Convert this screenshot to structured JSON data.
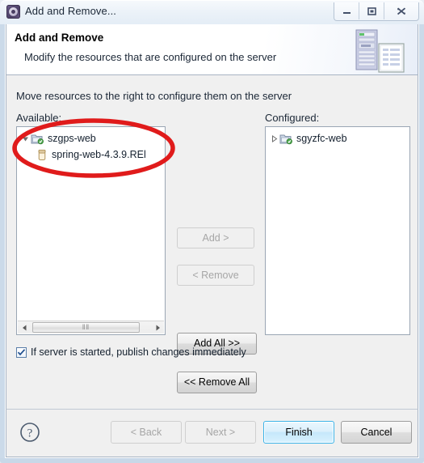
{
  "window": {
    "title": "Add and Remove...",
    "icon": "eclipse-server-icon",
    "controls": {
      "minimize": "minimize-button",
      "restore": "restore-button",
      "close": "close-button"
    }
  },
  "header": {
    "title": "Add and Remove",
    "subtitle": "Modify the resources that are configured on the server",
    "icon": "server-and-document-icon"
  },
  "main": {
    "instruction": "Move resources to the right to configure them on the server",
    "available": {
      "label": "Available:",
      "items": [
        {
          "label": "szgps-web",
          "level": 0,
          "expanded": true,
          "icon": "web-project-icon"
        },
        {
          "label": "spring-web-4.3.9.REl",
          "level": 1,
          "expanded": null,
          "icon": "jar-icon"
        }
      ],
      "scrollbar": {
        "left_arrow": "scroll-left-arrow",
        "right_arrow": "scroll-right-arrow",
        "thumb_grip": "‖‖"
      }
    },
    "configured": {
      "label": "Configured:",
      "items": [
        {
          "label": "sgyzfc-web",
          "level": 0,
          "expanded": false,
          "icon": "web-project-icon"
        }
      ]
    },
    "transfer_buttons": [
      {
        "label": "Add >",
        "enabled": false
      },
      {
        "label": "< Remove",
        "enabled": false
      },
      {
        "label": "Add All >>",
        "enabled": true
      },
      {
        "label": "<< Remove All",
        "enabled": true
      }
    ],
    "publish_checkbox": {
      "label": "If server is started, publish changes immediately",
      "checked": true
    }
  },
  "footer": {
    "help": "help-icon",
    "buttons": [
      {
        "label": "< Back",
        "state": "disabled"
      },
      {
        "label": "Next >",
        "state": "disabled"
      },
      {
        "label": "Finish",
        "state": "default"
      },
      {
        "label": "Cancel",
        "state": "normal"
      }
    ]
  },
  "annotation": {
    "shape": "ellipse",
    "color": "#e01b1b",
    "target": "available-tree-items"
  }
}
